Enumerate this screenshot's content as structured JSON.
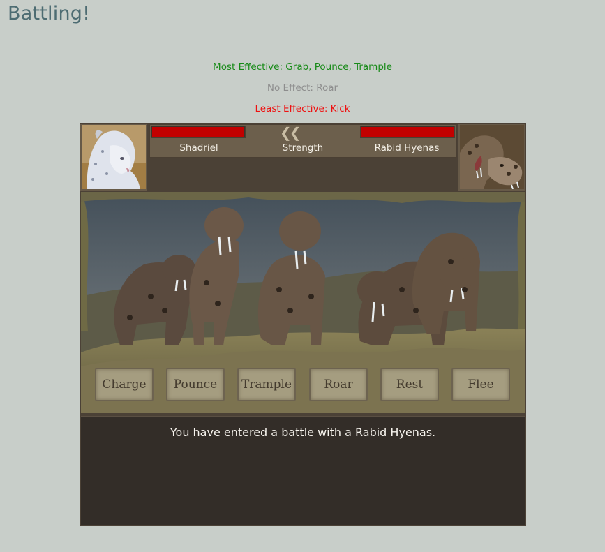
{
  "page": {
    "title": "Battling!"
  },
  "effectiveness": {
    "most": "Most Effective: Grab, Pounce, Trample",
    "none": "No Effect: Roar",
    "least": "Least Effective: Kick"
  },
  "battle": {
    "player_name": "Shadriel",
    "center_label": "Strength",
    "enemy_name": "Rabid Hyenas",
    "player_health_fraction": 1.0,
    "enemy_health_fraction": 1.0,
    "actions": [
      "Charge",
      "Pounce",
      "Trample",
      "Roar",
      "Rest",
      "Flee"
    ],
    "log": "You have entered a battle with a Rabid Hyenas."
  },
  "colors": {
    "background": "#c8cec9",
    "title": "#4d6c72",
    "most_effective": "#178a17",
    "no_effect": "#8d8d8d",
    "least_effective": "#ee1111",
    "health": "#c20000"
  },
  "icons": {
    "strength_indicator": "double-chevron-left-icon"
  }
}
